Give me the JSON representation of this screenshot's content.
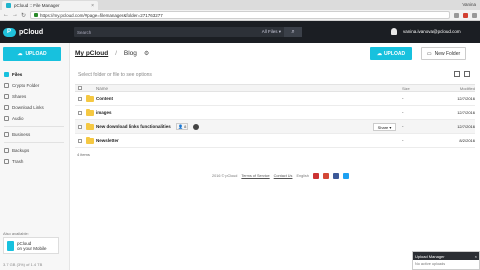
{
  "browser": {
    "tab_title": "pCloud :: File Manager",
    "tab_close": "×",
    "profile": "Vanina",
    "url": "https://my.pcloud.com/#page=filemanager&folder=271763277",
    "nav_back": "←",
    "nav_forward": "→",
    "nav_reload": "↻"
  },
  "header": {
    "logo_text": "pCloud",
    "search_placeholder": "Search",
    "search_filter": "All Files ▾",
    "search_button": "⌕",
    "user_email": "vanina.ivanova@pcloud.com"
  },
  "sidebar": {
    "upload_label": "UPLOAD",
    "items": [
      {
        "label": "Files",
        "active": true,
        "icon": "files-icon"
      },
      {
        "label": "Crypto Folder",
        "icon": "lock-icon"
      },
      {
        "label": "Shares",
        "icon": "share-icon"
      },
      {
        "label": "Download Links",
        "icon": "link-icon"
      },
      {
        "label": "Audio",
        "icon": "audio-icon"
      },
      {
        "label": "Business",
        "icon": "business-icon"
      },
      {
        "label": "Backups",
        "icon": "backup-icon"
      },
      {
        "label": "Trash",
        "icon": "trash-icon"
      }
    ],
    "also_available": "Also available:",
    "mobile_line1": "pCloud",
    "mobile_line2": "on your Mobile",
    "quota": "3.7 GB (3%) of 1.4 TB"
  },
  "main": {
    "crumb_root": "My pCloud",
    "crumb_separator": "/",
    "crumb_current": "Blog",
    "upload_label": "UPLOAD",
    "new_folder_label": "New Folder",
    "hint": "Select folder or file to see options",
    "columns": {
      "name": "Name",
      "size": "Size",
      "modified": "Modified"
    },
    "rows": [
      {
        "name": "Content",
        "size": "-",
        "modified": "12/7/2016"
      },
      {
        "name": "images",
        "size": "-",
        "modified": "12/7/2016"
      },
      {
        "name": "New download links functionalities",
        "size": "-",
        "modified": "12/7/2016",
        "shared": "8",
        "share_button": "Share ▾"
      },
      {
        "name": "Newsletter",
        "size": "-",
        "modified": "8/2/2016"
      }
    ],
    "count": "4 items"
  },
  "footer": {
    "copyright": "2016 © pCloud",
    "terms": "Terms of Service",
    "contact": "Contact Us",
    "language": "English"
  },
  "upload_manager": {
    "title": "Upload Manager",
    "status": "No active uploads",
    "close": "×"
  },
  "colors": {
    "accent": "#17c1de",
    "header_bg": "#1b1e23",
    "folder": "#f5c842"
  }
}
